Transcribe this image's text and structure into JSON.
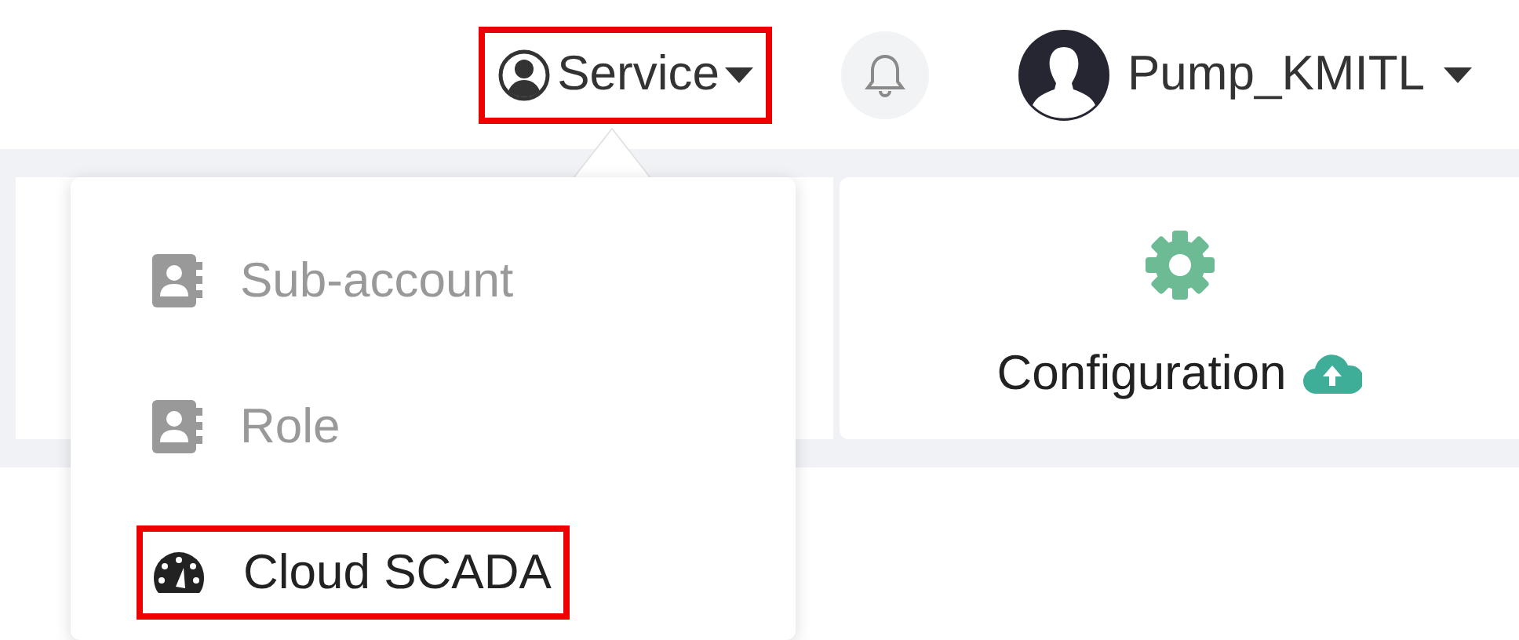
{
  "header": {
    "service_menu": {
      "label": "Service",
      "highlighted": true
    },
    "user": {
      "name": "Pump_KMITL"
    }
  },
  "service_dropdown": {
    "items": [
      {
        "label": "Sub-account",
        "kind": "contact",
        "disabled": true,
        "highlighted": false
      },
      {
        "label": "Role",
        "kind": "contact",
        "disabled": true,
        "highlighted": false
      },
      {
        "label": "Cloud SCADA",
        "kind": "gauge",
        "disabled": false,
        "highlighted": true
      }
    ]
  },
  "cards": [
    {
      "label": "Configuration"
    }
  ]
}
